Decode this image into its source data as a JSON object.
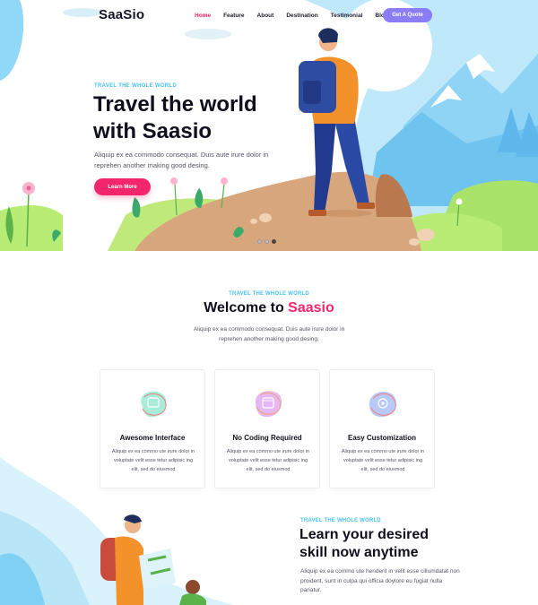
{
  "nav": {
    "logo": "SaaSio",
    "links": [
      "Home",
      "Feature",
      "About",
      "Destination",
      "Testimonial",
      "Blog"
    ],
    "active_index": 0,
    "cta": "Get A Quote"
  },
  "hero": {
    "eyebrow": "TRAVEL THE WHOLE WORLD",
    "title_line1": "Travel the world",
    "title_line2": "with Saasio",
    "text": "Aliquip ex ea commodo consequat. Duis aute irure dolor in reprehen another making good desing.",
    "button": "Learn More",
    "slides": 3,
    "active_slide": 2
  },
  "welcome": {
    "eyebrow": "TRAVEL THE WHOLE WORLD",
    "title_prefix": "Welcome to",
    "title_accent": "Saasio",
    "text": "Aliquip ex ea commodo consequat. Duis aute irure dolor in reprehen another making good desing."
  },
  "features": [
    {
      "title": "Awesome Interface",
      "icon": "interface-icon",
      "text": "Aliquip ex ea commo ute irure dolor in voluptate velit esse tetur adipisic ing elit, sed do eiusmod"
    },
    {
      "title": "No Coding Required",
      "icon": "calendar-icon",
      "text": "Aliquip ex ea commo ute irure dolor in voluptate velit esse tetur adipisic ing elit, sed do eiusmod"
    },
    {
      "title": "Easy Customization",
      "icon": "gear-icon",
      "text": "Aliquip ex ea commo ute irure dolor in voluptate velit esse tetur adipisic ing elit, sed do eiusmod"
    }
  ],
  "skill": {
    "eyebrow": "TRAVEL THE WHOLE WORLD",
    "title_line1": "Learn your desired",
    "title_line2": "skill now anytime",
    "text": "Aliquip ex ea commo ute henderit in velit esse cillumdatat non proident, sunt in culpa qui officia doylore eu fugiat nulla pariatur."
  },
  "colors": {
    "accent_pink": "#f3266d",
    "accent_blue": "#47c3f0",
    "cta_purple": "#8b7df6"
  }
}
